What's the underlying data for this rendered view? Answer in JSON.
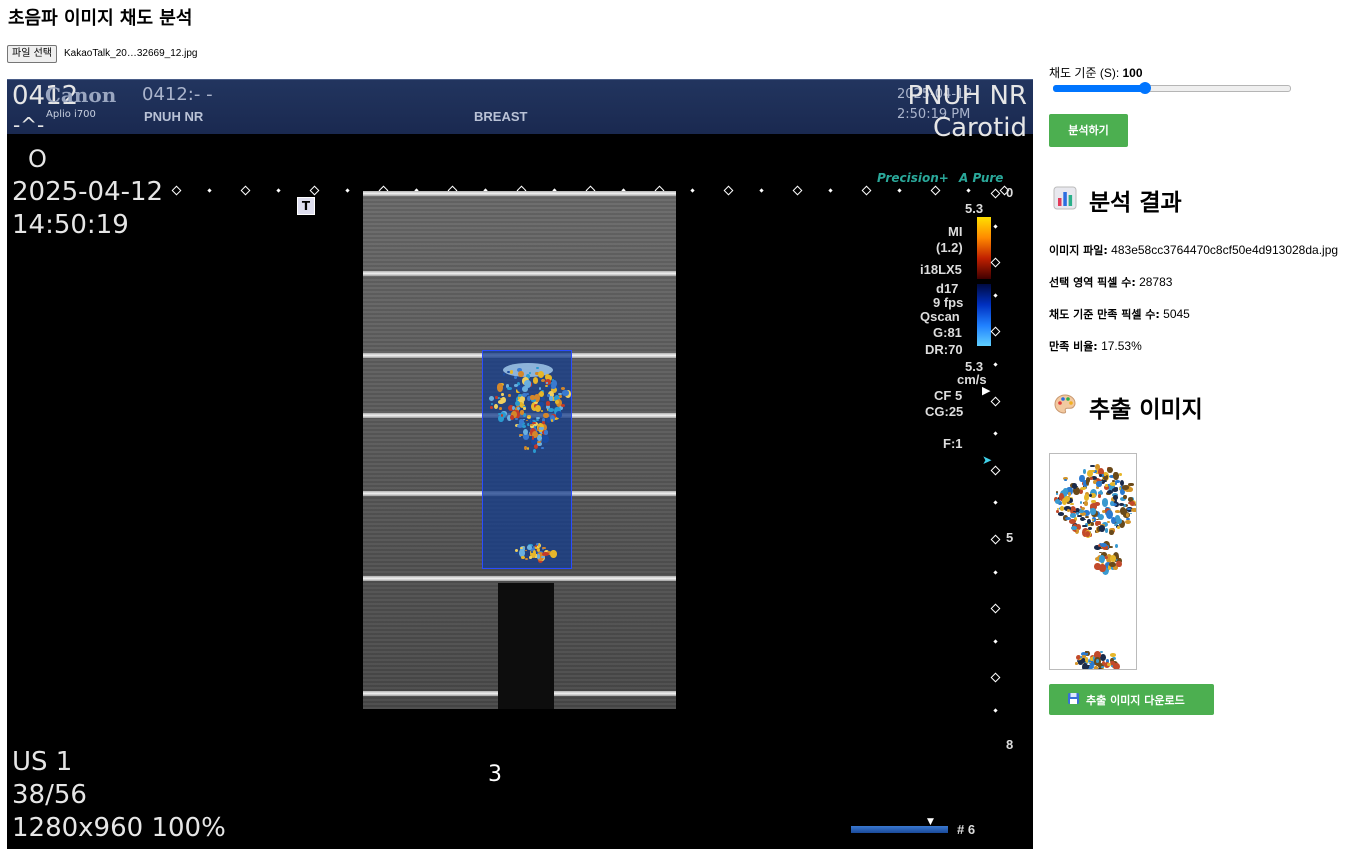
{
  "page": {
    "title": "초음파 이미지 채도 분석"
  },
  "file": {
    "button_label": "파일 선택",
    "file_name": "KakaoTalk_20…32669_12.jpg"
  },
  "viewer": {
    "header": {
      "id_top": "0412",
      "id_sub": "-^-",
      "letter": "O",
      "brand": "Canon",
      "model": "Aplio i700",
      "patient_code": "0412:- -",
      "institution": "PNUH NR",
      "exam": "BREAST",
      "date_top": "2025-04-12",
      "time_top": "2:50:19 PM",
      "hospital_large": "PNUH NR",
      "preset_large": "Carotid"
    },
    "date": "2025-04-12",
    "time": "14:50:19",
    "tags": {
      "precision": "Precision+",
      "apure": "A Pure",
      "t_marker": "T"
    },
    "params": {
      "scale_top": "5.3",
      "mi": "MI",
      "mi_value": "(1.2)",
      "probe": "i18LX5",
      "depth": "d17",
      "fps": "9 fps",
      "qscan": "Qscan",
      "gain": "G:81",
      "dr": "DR:70",
      "scale_bottom": "5.3",
      "unit": "cm/s",
      "cf": "CF 5",
      "cg": "CG:25",
      "focus": "F:1"
    },
    "depth_labels": [
      "0",
      "5",
      "8"
    ],
    "bottom_left": [
      "US 1",
      "38/56",
      "1280x960 100%"
    ],
    "frame_number": "3",
    "cine_label": "# 6"
  },
  "controls": {
    "saturation_label": "채도 기준 (S): ",
    "saturation_value": "100",
    "saturation_fraction": 0.39,
    "analyze_button": "분석하기"
  },
  "results": {
    "heading": "분석 결과",
    "icon": "bar-chart-icon",
    "items": [
      {
        "label": "이미지 파일:",
        "value": "483e58cc3764470c8cf50e4d913028da.jpg"
      },
      {
        "label": "선택 영역 픽셀 수:",
        "value": "28783"
      },
      {
        "label": "채도 기준 만족 픽셀 수:",
        "value": "5045"
      },
      {
        "label": "만족 비율:",
        "value": "17.53%"
      }
    ]
  },
  "extracted": {
    "heading": "추출 이미지",
    "icon": "palette-icon",
    "download_button": "추출 이미지 다운로드",
    "download_icon": "floppy-disk-icon"
  },
  "colors": {
    "accent_green": "#4caf50",
    "slider_blue": "#0075ff",
    "roi_blue": "#2a4cff"
  }
}
